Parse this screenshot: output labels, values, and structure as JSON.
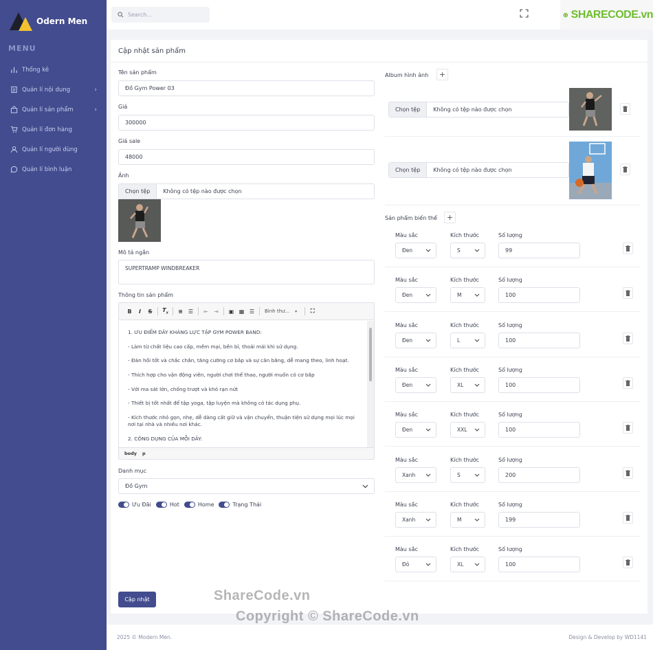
{
  "brand": {
    "name": "Odern Men"
  },
  "sidebar": {
    "menu_title": "MENU",
    "items": [
      {
        "label": "Thống kê",
        "icon": "bar-chart-icon",
        "has_children": false
      },
      {
        "label": "Quản lí nội dung",
        "icon": "document-icon",
        "has_children": true
      },
      {
        "label": "Quản lí sản phẩm",
        "icon": "bag-icon",
        "has_children": true
      },
      {
        "label": "Quản lí đơn hàng",
        "icon": "cart-icon",
        "has_children": false
      },
      {
        "label": "Quản lí người dùng",
        "icon": "user-icon",
        "has_children": false
      },
      {
        "label": "Quản lí bình luận",
        "icon": "comment-icon",
        "has_children": false
      }
    ]
  },
  "topbar": {
    "search_placeholder": "Search...",
    "sharecode_logo": "SHARECODE.vn"
  },
  "form": {
    "title": "Cập nhật sản phẩm",
    "name_label": "Tên sản phẩm",
    "name_value": "Đồ Gym Power 03",
    "price_label": "Giá",
    "price_value": "300000",
    "sale_label": "Giá sale",
    "sale_value": "48000",
    "image_label": "Ảnh",
    "file_button": "Chọn tệp",
    "file_none": "Không có tệp nào được chọn",
    "short_desc_label": "Mô tả ngắn",
    "short_desc_value": "SUPERTRAMP WINDBREAKER",
    "info_label": "Thông tin sản phẩm",
    "editor_format": "Bình thư...",
    "editor_paragraphs": [
      "1. ƯU ĐIỂM DÂY KHÁNG LỰC TẬP GYM POWER BAND:",
      "- Làm từ chất liệu cao cấp, mềm mại, bền bỉ, thoải mái khi sử dụng.",
      "- Đàn hồi tốt và chắc chắn, tăng cường cơ bắp và sự cân bằng, dễ mang theo, linh hoạt.",
      "- Thích hợp cho vận động viên, người chơi thể thao, người muốn có cơ bắp",
      "- Với ma sát lớn, chống trượt và khó rạn nứt",
      "- Thiết bị tốt nhất để tập yoga, tập luyện mà không có tác dụng phụ.",
      "- Kích thước nhỏ gọn, nhẹ, dễ dàng cất giữ và vận chuyển, thuận tiện sử dụng mọi lúc mọi nơi tại nhà và nhiều nơi khác.",
      "2. CÔNG DỤNG CỦA MỖI DÂY:"
    ],
    "editor_path": [
      "body",
      "p"
    ],
    "category_label": "Danh mục",
    "category_value": "Đồ Gym",
    "toggles": [
      "Ưu Đãi",
      "Hot",
      "Home",
      "Trạng Thái"
    ],
    "submit": "Cập nhật"
  },
  "album": {
    "label": "Album hình ảnh",
    "file_button": "Chọn tệp",
    "file_none": "Không có tệp nào được chọn"
  },
  "variants": {
    "label": "Sản phẩm biến thể",
    "color_label": "Màu sắc",
    "size_label": "Kích thước",
    "qty_label": "Số lượng",
    "rows": [
      {
        "color": "Đen",
        "size": "S",
        "qty": "99"
      },
      {
        "color": "Đen",
        "size": "M",
        "qty": "100"
      },
      {
        "color": "Đen",
        "size": "L",
        "qty": "100"
      },
      {
        "color": "Đen",
        "size": "XL",
        "qty": "100"
      },
      {
        "color": "Đen",
        "size": "XXL",
        "qty": "100"
      },
      {
        "color": "Xanh",
        "size": "S",
        "qty": "200"
      },
      {
        "color": "Xanh",
        "size": "M",
        "qty": "199"
      },
      {
        "color": "Đỏ",
        "size": "XL",
        "qty": "100"
      }
    ]
  },
  "footer": {
    "left": "2025 © Modern Men.",
    "right": "Design & Develop by WD1141"
  },
  "watermarks": {
    "top": "ShareCode.vn",
    "bottom": "Copyright © ShareCode.vn"
  },
  "colors": {
    "sidebar": "#424c8e",
    "primary": "#424c8e",
    "accent": "#f2c230"
  }
}
